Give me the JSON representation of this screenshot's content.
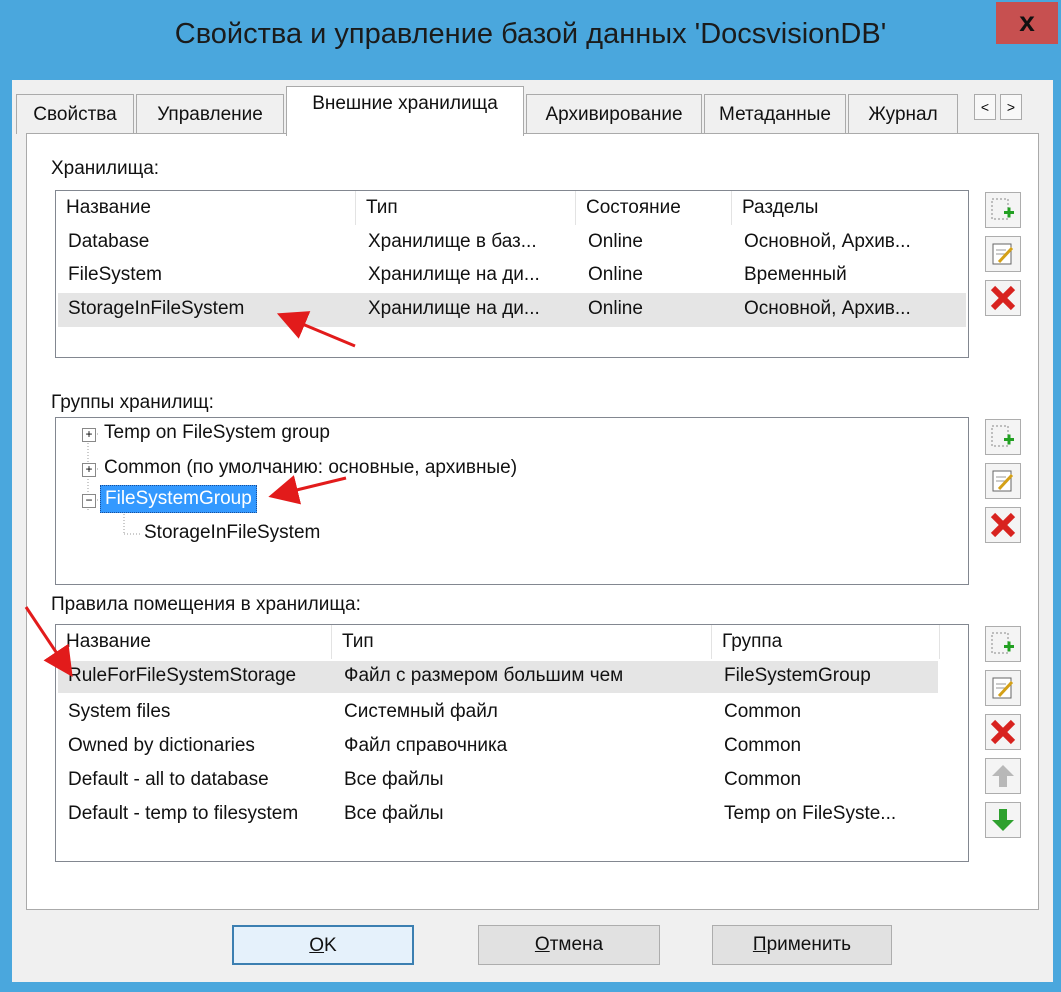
{
  "window": {
    "title": "Свойства и управление базой данных 'DocsvisionDB'",
    "close_glyph": "x"
  },
  "tabs": [
    {
      "label": "Свойства"
    },
    {
      "label": "Управление"
    },
    {
      "label": "Внешние хранилища"
    },
    {
      "label": "Архивирование"
    },
    {
      "label": "Метаданные"
    },
    {
      "label": "Журнал"
    }
  ],
  "tab_scroll": {
    "left": "<",
    "right": ">"
  },
  "storages": {
    "label": "Хранилища:",
    "columns": [
      "Название",
      "Тип",
      "Состояние",
      "Разделы"
    ],
    "rows": [
      [
        "Database",
        "Хранилище в баз...",
        "Online",
        "Основной, Архив..."
      ],
      [
        "FileSystem",
        "Хранилище на ди...",
        "Online",
        "Временный"
      ],
      [
        "StorageInFileSystem",
        "Хранилище на ди...",
        "Online",
        "Основной, Архив..."
      ]
    ]
  },
  "groups": {
    "label": "Группы хранилищ:",
    "items": [
      {
        "label": "Temp on FileSystem group",
        "expander": "+"
      },
      {
        "label": "Common (по умолчанию: основные, архивные)",
        "expander": "+"
      },
      {
        "label": "FileSystemGroup",
        "expander": "−"
      },
      {
        "label": "StorageInFileSystem"
      }
    ]
  },
  "rules": {
    "label": "Правила помещения в хранилища:",
    "columns": [
      "Название",
      "Тип",
      "Группа"
    ],
    "rows": [
      [
        "RuleForFileSystemStorage",
        "Файл с размером большим чем",
        "FileSystemGroup"
      ],
      [
        "System files",
        "Системный файл",
        "Common"
      ],
      [
        "Owned by dictionaries",
        "Файл справочника",
        "Common"
      ],
      [
        "Default - all to database",
        "Все файлы",
        "Common"
      ],
      [
        "Default - temp to filesystem",
        "Все файлы",
        "Temp on FileSyste..."
      ]
    ]
  },
  "buttons": {
    "ok": {
      "accel": "O",
      "rest": "K"
    },
    "cancel": {
      "accel": "О",
      "rest": "тмена"
    },
    "apply": {
      "accel": "П",
      "rest": "рименить"
    }
  },
  "colors": {
    "accent": "#4aa7dd",
    "close": "#c75050",
    "selection": "#3399ff",
    "annotation": "#e21b1b"
  }
}
